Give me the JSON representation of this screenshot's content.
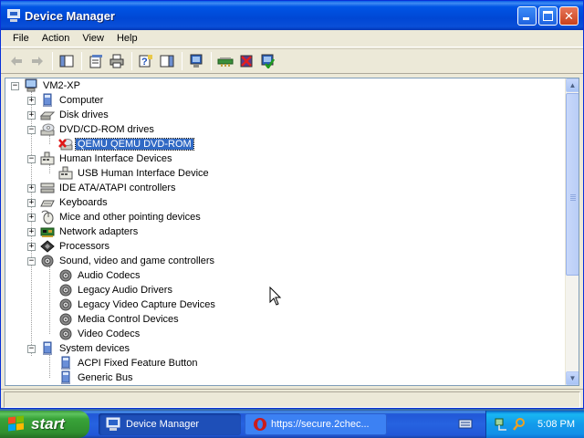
{
  "window": {
    "title": "Device Manager",
    "controls": {
      "minimize": "minimize",
      "maximize": "maximize",
      "close": "close"
    }
  },
  "menu": [
    "File",
    "Action",
    "View",
    "Help"
  ],
  "toolbar": {
    "buttons": [
      "back-icon",
      "forward-icon",
      "show-hide-console-tree-icon",
      "properties-icon",
      "print-icon",
      "help-icon",
      "show-hide-action-pane-icon",
      "computer-scan-icon",
      "update-driver-icon",
      "uninstall-icon",
      "enable-icon"
    ]
  },
  "tree": {
    "root": "VM2-XP",
    "nodes": [
      {
        "label": "Computer",
        "icon": "computer-icon",
        "expanded": false
      },
      {
        "label": "Disk drives",
        "icon": "disk-drive-icon",
        "expanded": false
      },
      {
        "label": "DVD/CD-ROM drives",
        "icon": "cdrom-icon",
        "expanded": true,
        "children": [
          {
            "label": "QEMU QEMU DVD-ROM",
            "icon": "disabled-cdrom-icon",
            "selected": true
          }
        ]
      },
      {
        "label": "Human Interface Devices",
        "icon": "hid-icon",
        "expanded": true,
        "children": [
          {
            "label": "USB Human Interface Device",
            "icon": "hid-icon"
          }
        ]
      },
      {
        "label": "IDE ATA/ATAPI controllers",
        "icon": "ide-controller-icon",
        "expanded": false
      },
      {
        "label": "Keyboards",
        "icon": "keyboard-icon",
        "expanded": false
      },
      {
        "label": "Mice and other pointing devices",
        "icon": "mouse-icon",
        "expanded": false
      },
      {
        "label": "Network adapters",
        "icon": "network-adapter-icon",
        "expanded": false
      },
      {
        "label": "Processors",
        "icon": "processor-icon",
        "expanded": false
      },
      {
        "label": "Sound, video and game controllers",
        "icon": "sound-icon",
        "expanded": true,
        "children": [
          {
            "label": "Audio Codecs",
            "icon": "sound-icon"
          },
          {
            "label": "Legacy Audio Drivers",
            "icon": "sound-icon"
          },
          {
            "label": "Legacy Video Capture Devices",
            "icon": "sound-icon"
          },
          {
            "label": "Media Control Devices",
            "icon": "sound-icon"
          },
          {
            "label": "Video Codecs",
            "icon": "sound-icon"
          }
        ]
      },
      {
        "label": "System devices",
        "icon": "system-device-icon",
        "expanded": true,
        "children": [
          {
            "label": "ACPI Fixed Feature Button",
            "icon": "system-device-icon"
          },
          {
            "label": "Generic Bus",
            "icon": "system-device-icon"
          }
        ]
      }
    ]
  },
  "taskbar": {
    "start_label": "start",
    "tasks": [
      {
        "label": "Device Manager",
        "active": true
      },
      {
        "label": "https://secure.2chec...",
        "active": false
      }
    ],
    "clock": "5:08 PM"
  },
  "colors": {
    "titlebar": "#0055e5",
    "selection": "#316ac5",
    "taskbar": "#2663e0",
    "start": "#39a339"
  }
}
